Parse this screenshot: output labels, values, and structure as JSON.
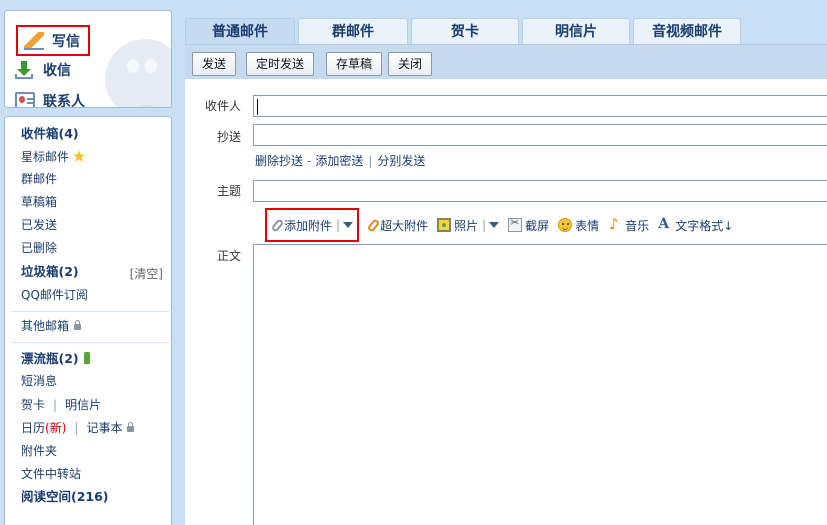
{
  "actions": {
    "write": "写信",
    "inbox": "收信",
    "contacts": "联系人"
  },
  "nav": {
    "inbox": "收件箱(4)",
    "starred": "星标邮件",
    "group": "群邮件",
    "drafts": "草稿箱",
    "sent": "已发送",
    "deleted": "已删除",
    "spam": "垃圾箱(2)",
    "spam_clear": "[清空]",
    "qq_subscribe": "QQ邮件订阅",
    "other_mailbox": "其他邮箱",
    "drift_bottle": "漂流瓶(2)",
    "sms": "短消息",
    "greeting_card": "贺卡",
    "postcard": "明信片",
    "calendar": "日历",
    "calendar_new": "(新)",
    "notepad": "记事本",
    "attachments": "附件夹",
    "file_transfer": "文件中转站",
    "reading_space": "阅读空间(216)"
  },
  "tabs": [
    "普通邮件",
    "群邮件",
    "贺卡",
    "明信片",
    "音视频邮件"
  ],
  "toolbar": {
    "send": "发送",
    "scheduled_send": "定时发送",
    "save_draft": "存草稿",
    "close": "关闭"
  },
  "form": {
    "to_label": "收件人",
    "cc_label": "抄送",
    "remove_cc": "删除抄送",
    "add_bcc": "添加密送",
    "separate_send": "分别发送",
    "subject_label": "主题",
    "body_label": "正文",
    "to_value": "",
    "cc_value": "",
    "subject_value": ""
  },
  "editor_tools": {
    "add_attachment": "添加附件",
    "large_attachment": "超大附件",
    "photo": "照片",
    "screenshot": "截屏",
    "emoticon": "表情",
    "music": "音乐",
    "text_format": "文字格式↓"
  },
  "colors": {
    "highlight": "#e3000b",
    "link": "#1a3c6e",
    "background": "#c9dff3"
  }
}
